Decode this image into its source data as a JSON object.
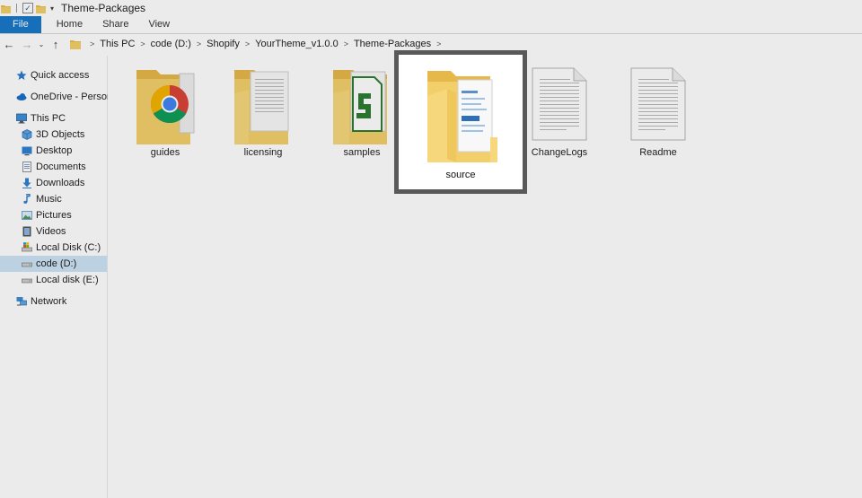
{
  "window": {
    "title": "Theme-Packages"
  },
  "ribbon": {
    "tabs": [
      "File",
      "Home",
      "Share",
      "View"
    ]
  },
  "address": {
    "crumbs": [
      "This PC",
      "code (D:)",
      "Shopify",
      "YourTheme_v1.0.0",
      "Theme-Packages"
    ]
  },
  "nav": {
    "quick_access": "Quick access",
    "onedrive": "OneDrive - Personal",
    "this_pc": "This PC",
    "items": [
      {
        "label": "3D Objects",
        "icon": "cube-icon"
      },
      {
        "label": "Desktop",
        "icon": "desktop-icon"
      },
      {
        "label": "Documents",
        "icon": "documents-icon"
      },
      {
        "label": "Downloads",
        "icon": "download-icon"
      },
      {
        "label": "Music",
        "icon": "music-icon"
      },
      {
        "label": "Pictures",
        "icon": "pictures-icon"
      },
      {
        "label": "Videos",
        "icon": "videos-icon"
      },
      {
        "label": "Local Disk (C:)",
        "icon": "drive-icon"
      },
      {
        "label": "code (D:)",
        "icon": "drive-icon"
      },
      {
        "label": "Local disk (E:)",
        "icon": "drive-icon"
      }
    ],
    "network": "Network"
  },
  "files": [
    {
      "name": "guides",
      "kind": "folder-chrome"
    },
    {
      "name": "licensing",
      "kind": "folder-doc"
    },
    {
      "name": "samples",
      "kind": "folder-green"
    },
    {
      "name": "source",
      "kind": "folder-doc"
    },
    {
      "name": "ChangeLogs",
      "kind": "text-file"
    },
    {
      "name": "Readme",
      "kind": "text-file"
    }
  ],
  "highlighted": "source",
  "colors": {
    "accent": "#1979ca",
    "folder": "#f3cf6b",
    "selection": "#cce4f7"
  }
}
